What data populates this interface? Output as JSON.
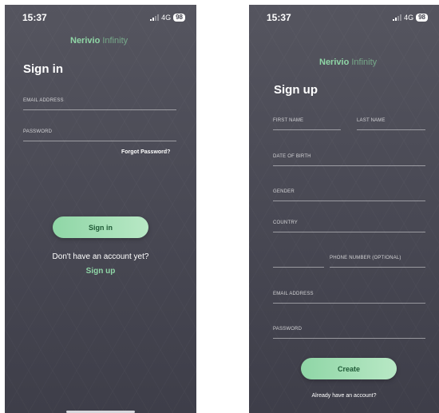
{
  "status_bar": {
    "time": "15:37",
    "network": "4G",
    "battery": "98"
  },
  "brand": {
    "name": "Nerivio",
    "suffix": "Infinity"
  },
  "sign_in": {
    "title": "Sign in",
    "email_label": "EMAIL ADDRESS",
    "password_label": "PASSWORD",
    "forgot_password": "Forgot Password?",
    "button_label": "Sign in",
    "no_account_prompt": "Don't have an account yet?",
    "sign_up_link": "Sign up"
  },
  "sign_up": {
    "title": "Sign up",
    "first_name_label": "FIRST NAME",
    "last_name_label": "LAST NAME",
    "dob_label": "DATE OF BIRTH",
    "gender_label": "GENDER",
    "country_label": "COUNTRY",
    "phone_label": "PHONE NUMBER (OPTIONAL)",
    "email_label": "EMAIL ADDRESS",
    "password_label": "PASSWORD",
    "button_label": "Create",
    "have_account_prompt": "Already have an account?"
  },
  "colors": {
    "accent": "#8fd6a6",
    "background_top": "#55555f",
    "background_bottom": "#3e3e49"
  }
}
